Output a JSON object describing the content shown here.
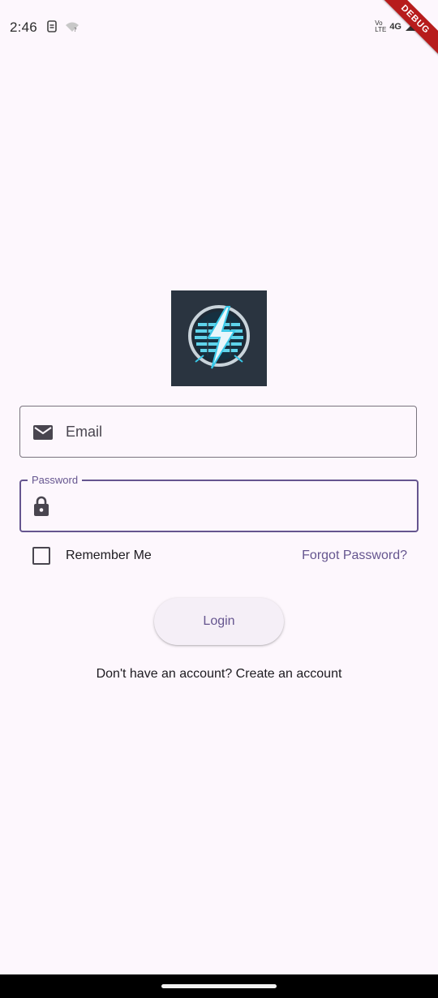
{
  "status_bar": {
    "time": "2:46",
    "volte_top": "Vo",
    "volte_bottom": "LTE",
    "network": "4G",
    "icons": [
      "sim-icon",
      "wifi-question-icon",
      "signal-icon",
      "battery-icon"
    ]
  },
  "debug_banner": "DEBUG",
  "logo": {
    "icon": "lightning-bolt-logo",
    "background_color": "#2a3440",
    "accent_color": "#39c8e8"
  },
  "login_form": {
    "email": {
      "placeholder": "Email",
      "icon": "mail-icon"
    },
    "password": {
      "label": "Password",
      "value": "",
      "icon": "lock-icon"
    },
    "remember_me": {
      "label": "Remember Me",
      "checked": false
    },
    "forgot_password": "Forgot Password?",
    "login_button": "Login",
    "signup_prompt": "Don't have an account? Create an account"
  },
  "colors": {
    "background": "#fdf7fd",
    "primary": "#65558f",
    "outline": "#79747e",
    "on_surface": "#1d1b20"
  }
}
